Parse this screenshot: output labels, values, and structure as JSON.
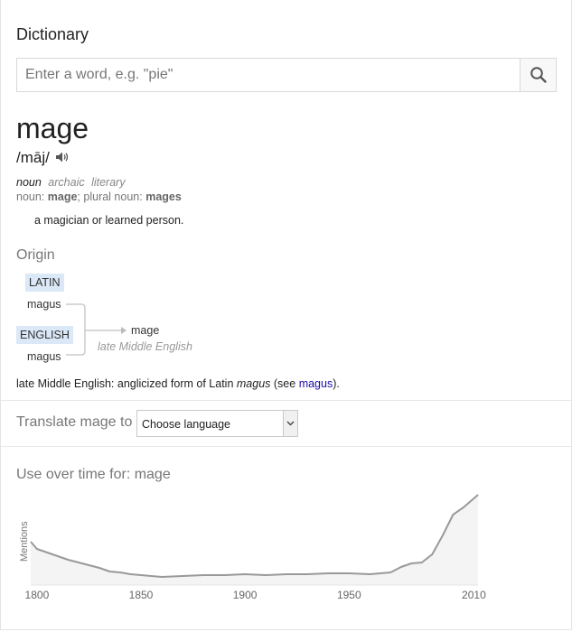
{
  "header": {
    "title": "Dictionary"
  },
  "search": {
    "placeholder": "Enter a word, e.g. \"pie\"",
    "value": "",
    "icon": "search-icon"
  },
  "entry": {
    "word": "mage",
    "phonetic": "/māj/",
    "audio_icon": "speaker-icon",
    "part_of_speech": "noun",
    "labels": [
      "archaic",
      "literary"
    ],
    "forms": {
      "noun_label": "noun:",
      "noun": "mage",
      "separator": ";",
      "plural_label": "plural noun:",
      "plural": "mages"
    },
    "definition": "a magician or learned person."
  },
  "origin": {
    "heading": "Origin",
    "languages": [
      {
        "lang": "LATIN",
        "word": "magus"
      },
      {
        "lang": "ENGLISH",
        "word": "magus"
      }
    ],
    "result_word": "mage",
    "result_note": "late Middle English",
    "text_before": "late Middle English: anglicized form of Latin ",
    "text_italic": "magus",
    "text_mid": " (see ",
    "link": "magus",
    "text_after": ")."
  },
  "translate": {
    "label": "Translate mage to",
    "select_value": "Choose language"
  },
  "usage": {
    "heading": "Use over time for: mage"
  },
  "chart_data": {
    "type": "area",
    "title": "Use over time for: mage",
    "ylabel": "Mentions",
    "xlabel": "",
    "x_ticks": [
      "1800",
      "1850",
      "1900",
      "1950",
      "2010"
    ],
    "xlim": [
      1797,
      2012
    ],
    "ylim": [
      0,
      1
    ],
    "x": [
      1797,
      1800,
      1805,
      1810,
      1815,
      1820,
      1825,
      1830,
      1835,
      1840,
      1845,
      1850,
      1855,
      1860,
      1870,
      1880,
      1890,
      1900,
      1910,
      1920,
      1930,
      1940,
      1950,
      1960,
      1970,
      1975,
      1980,
      1985,
      1990,
      1995,
      2000,
      2005,
      2012
    ],
    "values": [
      0.48,
      0.4,
      0.36,
      0.32,
      0.28,
      0.25,
      0.22,
      0.19,
      0.15,
      0.14,
      0.12,
      0.11,
      0.1,
      0.09,
      0.1,
      0.11,
      0.11,
      0.12,
      0.11,
      0.12,
      0.12,
      0.13,
      0.13,
      0.12,
      0.14,
      0.2,
      0.24,
      0.25,
      0.34,
      0.55,
      0.78,
      0.86,
      1.0
    ],
    "colors": {
      "line": "#999999",
      "fill": "#f4f4f4"
    },
    "grid": false,
    "legend": "none"
  }
}
